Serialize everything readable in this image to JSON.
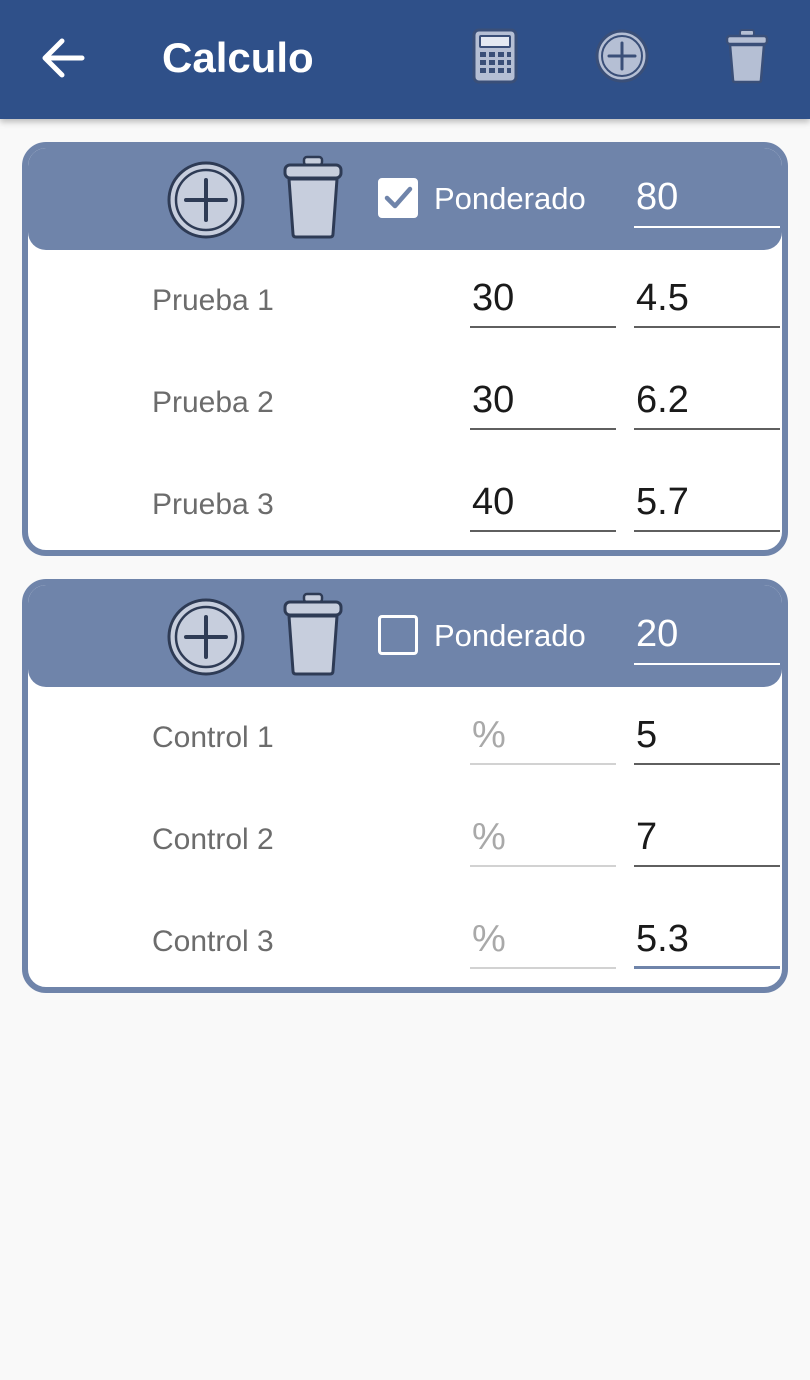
{
  "appbar": {
    "title": "Calculo",
    "icons": [
      "back-arrow-icon",
      "calculator-icon",
      "add-circle-icon",
      "trash-icon"
    ]
  },
  "colors": {
    "primary": "#2f5089",
    "card_accent": "#6f84aa",
    "background": "#f9f9f9"
  },
  "groups": [
    {
      "ponderado_label": "Ponderado",
      "ponderado_checked": true,
      "weight": "80",
      "rows": [
        {
          "label": "Prueba 1",
          "percent": "30",
          "grade": "4.5"
        },
        {
          "label": "Prueba 2",
          "percent": "30",
          "grade": "6.2"
        },
        {
          "label": "Prueba 3",
          "percent": "40",
          "grade": "5.7"
        }
      ]
    },
    {
      "ponderado_label": "Ponderado",
      "ponderado_checked": false,
      "weight": "20",
      "rows": [
        {
          "label": "Control 1",
          "percent_placeholder": "%",
          "grade": "5"
        },
        {
          "label": "Control 2",
          "percent_placeholder": "%",
          "grade": "7"
        },
        {
          "label": "Control 3",
          "percent_placeholder": "%",
          "grade": "5.3"
        }
      ]
    }
  ]
}
